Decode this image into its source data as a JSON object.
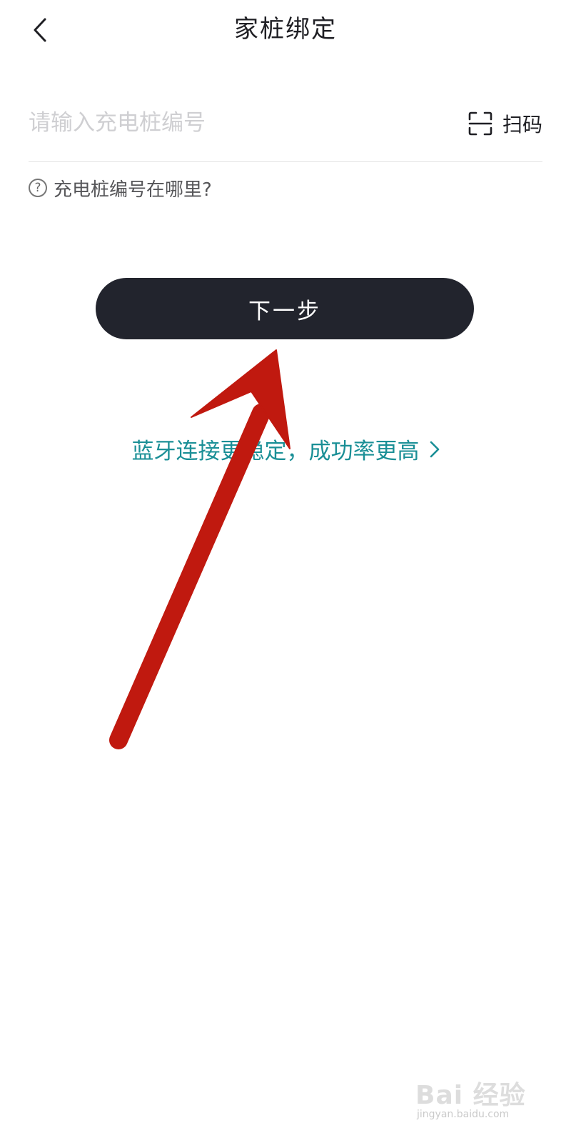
{
  "header": {
    "title": "家桩绑定",
    "back_icon": "chevron-left-icon"
  },
  "charger_input": {
    "value": "",
    "placeholder": "请输入充电桩编号"
  },
  "scan": {
    "label": "扫码",
    "icon": "scan-icon"
  },
  "help": {
    "icon": "question-circle-icon",
    "text": "充电桩编号在哪里?"
  },
  "next_button": {
    "label": "下一步"
  },
  "bluetooth_link": {
    "text": "蓝牙连接更稳定，成功率更高",
    "icon": "chevron-right-icon",
    "color": "#1a8f96"
  },
  "annotation": {
    "type": "arrow",
    "color": "#c0190f"
  },
  "watermark": {
    "logo_text": "Bai 经验",
    "sub_text": "jingyan.baidu.com"
  },
  "colors": {
    "primary_button": "#22242d",
    "accent": "#1a8f96"
  }
}
